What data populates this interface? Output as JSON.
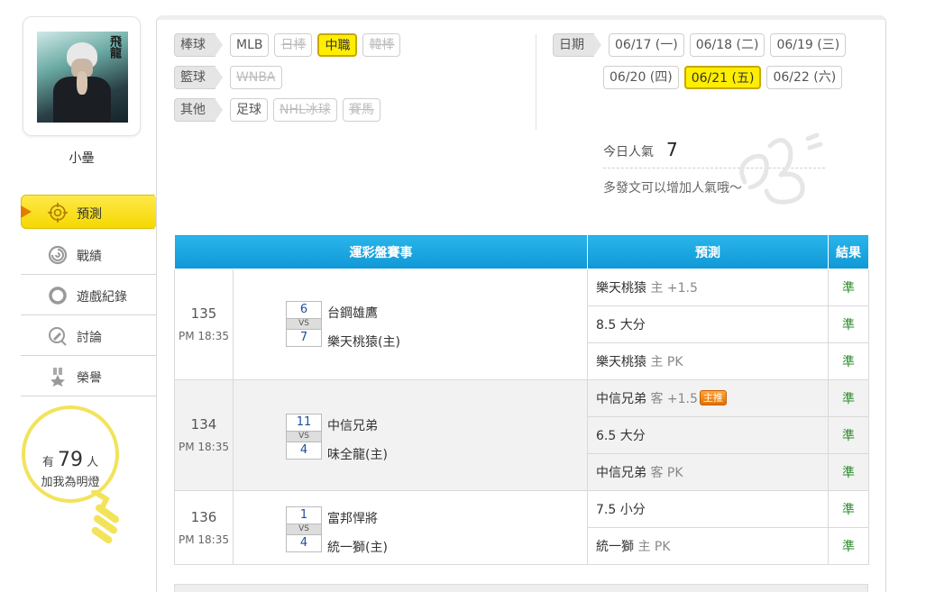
{
  "profile": {
    "username": "小壘",
    "avatar_glyph": "飛龍"
  },
  "nav": {
    "active": {
      "label": "預測",
      "icon": "target-icon"
    },
    "items": [
      {
        "label": "戰績",
        "icon": "chart-icon"
      },
      {
        "label": "遊戲紀錄",
        "icon": "ring-icon"
      },
      {
        "label": "討論",
        "icon": "discuss-icon"
      },
      {
        "label": "榮譽",
        "icon": "medal-icon"
      }
    ]
  },
  "fans": {
    "prefix": "有",
    "count": "79",
    "suffix": "人",
    "line2": "加我為明燈"
  },
  "filters": {
    "baseball": {
      "label": "棒球",
      "chips": [
        "MLB",
        "日棒",
        "中職",
        "韓棒"
      ]
    },
    "basketball": {
      "label": "籃球",
      "chips": [
        "WNBA"
      ]
    },
    "other": {
      "label": "其他",
      "chips": [
        "足球",
        "NHL冰球",
        "賽馬"
      ]
    },
    "date": {
      "label": "日期",
      "chips": [
        "06/17 (一)",
        "06/18 (二)",
        "06/19 (三)",
        "06/20 (四)",
        "06/21 (五)",
        "06/22 (六)"
      ]
    }
  },
  "popularity": {
    "label": "今日人氣",
    "value": "7",
    "hint": "多發文可以增加人氣哦～"
  },
  "table": {
    "headers": [
      "運彩盤賽事",
      "預測",
      "結果"
    ],
    "games": [
      {
        "no": "135",
        "time": "PM 18:35",
        "away_score": "6",
        "home_score": "7",
        "vs": "VS",
        "away": "台鋼雄鷹",
        "home": "樂天桃猿(主)",
        "preds": [
          {
            "main": "樂天桃猿",
            "muted": "主 +1.5",
            "badge": "",
            "result": "準"
          },
          {
            "main": "8.5 大分",
            "muted": "",
            "badge": "",
            "result": "準"
          },
          {
            "main": "樂天桃猿",
            "muted": "主 PK",
            "badge": "",
            "result": "準"
          }
        ]
      },
      {
        "no": "134",
        "time": "PM 18:35",
        "away_score": "11",
        "home_score": "4",
        "vs": "VS",
        "away": "中信兄弟",
        "home": "味全龍(主)",
        "preds": [
          {
            "main": "中信兄弟",
            "muted": "客 +1.5",
            "badge": "主推",
            "result": "準"
          },
          {
            "main": "6.5 大分",
            "muted": "",
            "badge": "",
            "result": "準"
          },
          {
            "main": "中信兄弟",
            "muted": "客 PK",
            "badge": "",
            "result": "準"
          }
        ]
      },
      {
        "no": "136",
        "time": "PM 18:35",
        "away_score": "1",
        "home_score": "4",
        "vs": "VS",
        "away": "富邦悍將",
        "home": "統一獅(主)",
        "preds": [
          {
            "main": "7.5 小分",
            "muted": "",
            "badge": "",
            "result": "準"
          },
          {
            "main": "統一獅",
            "muted": "主 PK",
            "badge": "",
            "result": "準"
          }
        ]
      }
    ]
  },
  "colors": {
    "accent_yellow": "#ffee00",
    "header_blue": "#1aa6e0",
    "result_green": "#2e8b2e",
    "badge_orange": "#f08a1c"
  }
}
